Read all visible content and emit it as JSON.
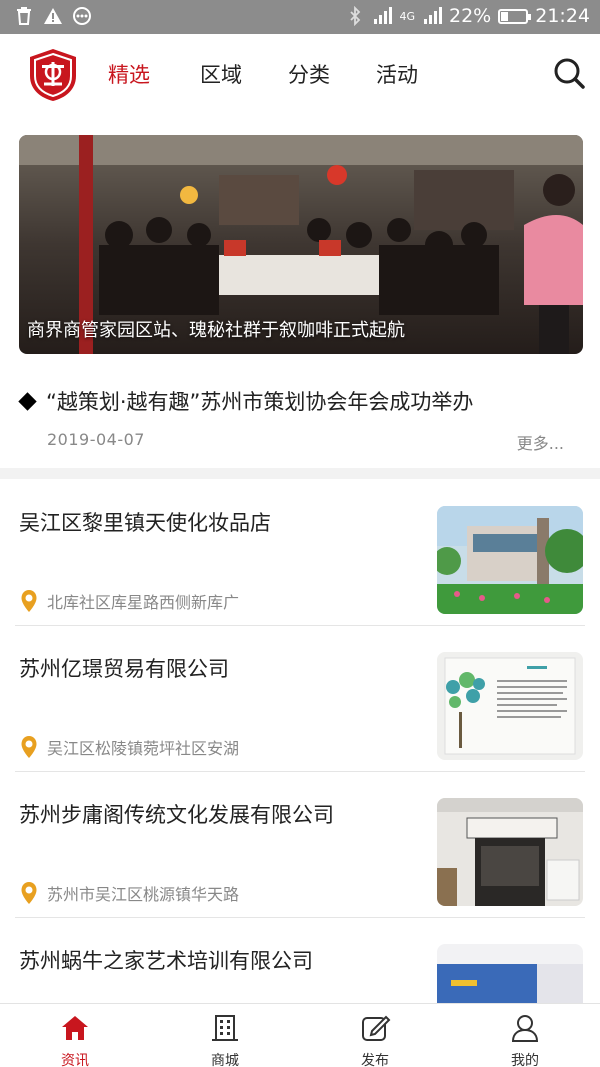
{
  "status_bar": {
    "network": "4G",
    "battery": "22%",
    "time": "21:24"
  },
  "header": {
    "tabs": [
      {
        "label": "精选",
        "active": true
      },
      {
        "label": "区域",
        "active": false
      },
      {
        "label": "分类",
        "active": false
      },
      {
        "label": "活动",
        "active": false
      }
    ],
    "icons": [
      "app-logo-icon",
      "search-icon"
    ]
  },
  "banner": {
    "caption": "商界商管家园区站、瑰秘社群于叙咖啡正式起航"
  },
  "headline": {
    "title": "“越策划·越有趣”苏州市策划协会年会成功举办",
    "date": "2019-04-07",
    "more": "更多..."
  },
  "listings": [
    {
      "name": "吴江区黎里镇天使化妆品店",
      "address": "北库社区库星路西侧新库广"
    },
    {
      "name": "苏州亿璟贸易有限公司",
      "address": "吴江区松陵镇菀坪社区安湖"
    },
    {
      "name": "苏州步庸阁传统文化发展有限公司",
      "address": "苏州市吴江区桃源镇华天路"
    },
    {
      "name": "苏州蜗牛之家艺术培训有限公司",
      "address": ""
    }
  ],
  "bottom_nav": [
    {
      "label": "资讯",
      "icon": "home-icon",
      "active": true
    },
    {
      "label": "商城",
      "icon": "building-icon",
      "active": false
    },
    {
      "label": "发布",
      "icon": "edit-icon",
      "active": false
    },
    {
      "label": "我的",
      "icon": "user-icon",
      "active": false
    }
  ],
  "colors": {
    "accent": "#c8161e",
    "pin": "#e8a020",
    "status_bar": "#8c8c8c"
  }
}
